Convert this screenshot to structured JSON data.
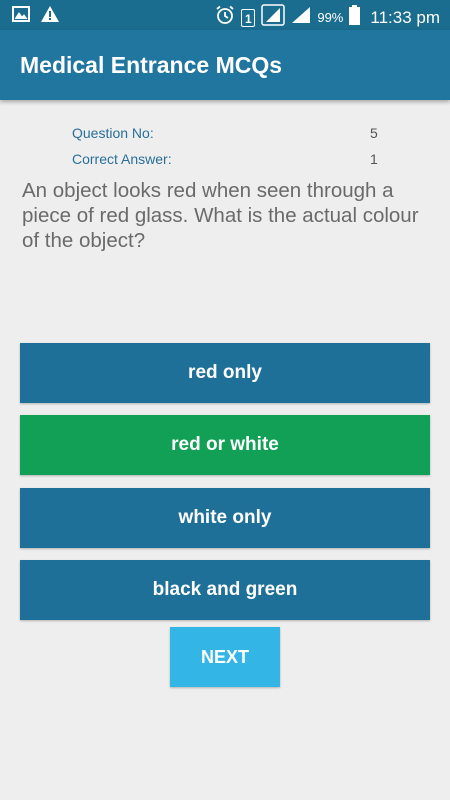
{
  "status_bar": {
    "sim_slot": "1",
    "battery_percent": "99%",
    "time": "11:33 pm",
    "icons": [
      "image-icon",
      "warning-icon",
      "alarm-icon",
      "sim-icon",
      "signal-icon",
      "signal-icon",
      "battery-icon"
    ]
  },
  "app_bar": {
    "title": "Medical Entrance MCQs"
  },
  "meta": {
    "question_no_label": "Question No:",
    "question_no_value": "5",
    "correct_answer_label": "Correct Answer:",
    "correct_answer_value": "1"
  },
  "question": {
    "text": "An object looks red when seen through a piece of red glass. What is the actual colour of the object?"
  },
  "options": [
    {
      "label": "red only",
      "state": "default"
    },
    {
      "label": "red or white",
      "state": "correct"
    },
    {
      "label": "white only",
      "state": "default"
    },
    {
      "label": "black and green",
      "state": "default"
    }
  ],
  "next_button": {
    "label": "NEXT"
  },
  "colors": {
    "status_bar": "#1a6d8f",
    "app_bar": "#2176a0",
    "option_default": "#1f7099",
    "option_correct": "#12a056",
    "next_button": "#33b5e5",
    "background": "#eeeeee"
  }
}
